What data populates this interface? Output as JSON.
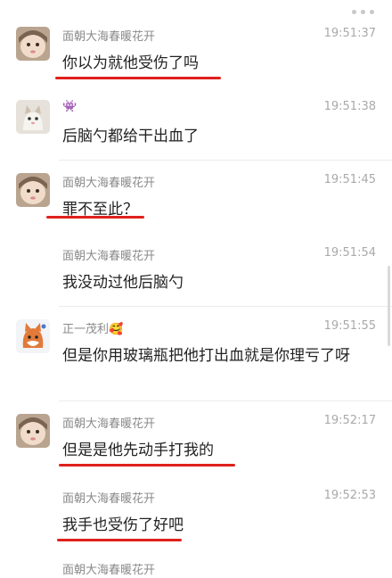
{
  "messages": [
    {
      "sender": "面朝大海春暖花开",
      "time": "19:51:37",
      "text": "你以为就他受伤了吗"
    },
    {
      "sender": "👾",
      "time": "19:51:38",
      "text": "后脑勺都给干出血了"
    },
    {
      "sender": "面朝大海春暖花开",
      "time": "19:51:45",
      "text": "罪不至此？"
    },
    {
      "sender": "面朝大海春暖花开",
      "time": "19:51:54",
      "text": "我没动过他后脑勺"
    },
    {
      "sender": "正一茂利🥰",
      "time": "19:51:55",
      "text": "但是你用玻璃瓶把他打出血就是你理亏了呀"
    },
    {
      "sender": "面朝大海春暖花开",
      "time": "19:52:17",
      "text": "但是是他先动手打我的"
    },
    {
      "sender": "面朝大海春暖花开",
      "time": "19:52:53",
      "text": "我手也受伤了好吧"
    },
    {
      "sender": "面朝大海春暖花开",
      "time": "",
      "text": ""
    }
  ],
  "colors": {
    "highlight_underline": "#e0201c",
    "sender": "#8a8a8a",
    "time": "#a9a9a9"
  },
  "icons": [
    "more-icon",
    "girl-avatar",
    "cat-avatar",
    "fox-avatar"
  ]
}
